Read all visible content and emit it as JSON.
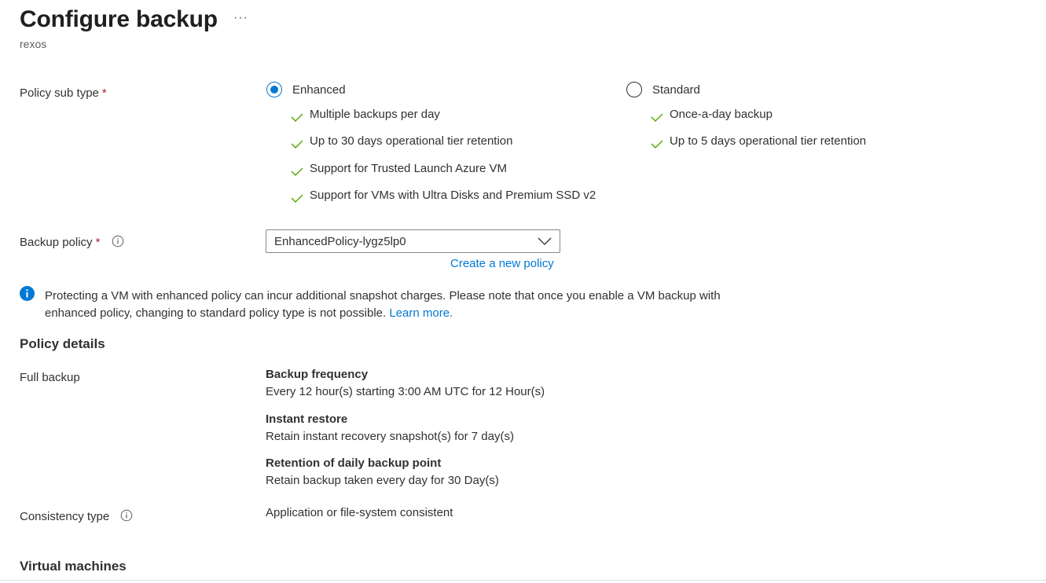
{
  "header": {
    "title": "Configure backup",
    "more_label": "···",
    "subtitle": "rexos"
  },
  "policy_sub_type": {
    "label": "Policy sub type",
    "required_marker": "*",
    "options": [
      {
        "label": "Enhanced",
        "selected": true,
        "features": [
          "Multiple backups per day",
          "Up to 30 days operational tier retention",
          "Support for Trusted Launch Azure VM",
          "Support for VMs with Ultra Disks and Premium SSD v2"
        ]
      },
      {
        "label": "Standard",
        "selected": false,
        "features": [
          "Once-a-day backup",
          "Up to 5 days operational tier retention"
        ]
      }
    ]
  },
  "backup_policy": {
    "label": "Backup policy",
    "required_marker": "*",
    "info_icon": "info-icon",
    "selected_value": "EnhancedPolicy-lygz5lp0",
    "create_link": "Create a new policy"
  },
  "info_bar": {
    "icon": "info-filled-icon",
    "text": "Protecting a VM with enhanced policy can incur additional snapshot charges. Please note that once you enable a VM backup with enhanced policy, changing to standard policy type is not possible.",
    "link": "Learn more."
  },
  "policy_details": {
    "heading": "Policy details",
    "full_backup_label": "Full backup",
    "items": [
      {
        "title": "Backup frequency",
        "value": "Every 12 hour(s) starting 3:00 AM UTC for 12 Hour(s)"
      },
      {
        "title": "Instant restore",
        "value": "Retain instant recovery snapshot(s) for 7 day(s)"
      },
      {
        "title": "Retention of daily backup point",
        "value": "Retain backup taken every day for 30 Day(s)"
      }
    ],
    "consistency_label": "Consistency type",
    "consistency_value": "Application or file-system consistent"
  },
  "virtual_machines": {
    "heading": "Virtual machines"
  },
  "colors": {
    "accent": "#0078d4",
    "check": "#57a300",
    "required": "#a4262c",
    "text": "#323130"
  }
}
